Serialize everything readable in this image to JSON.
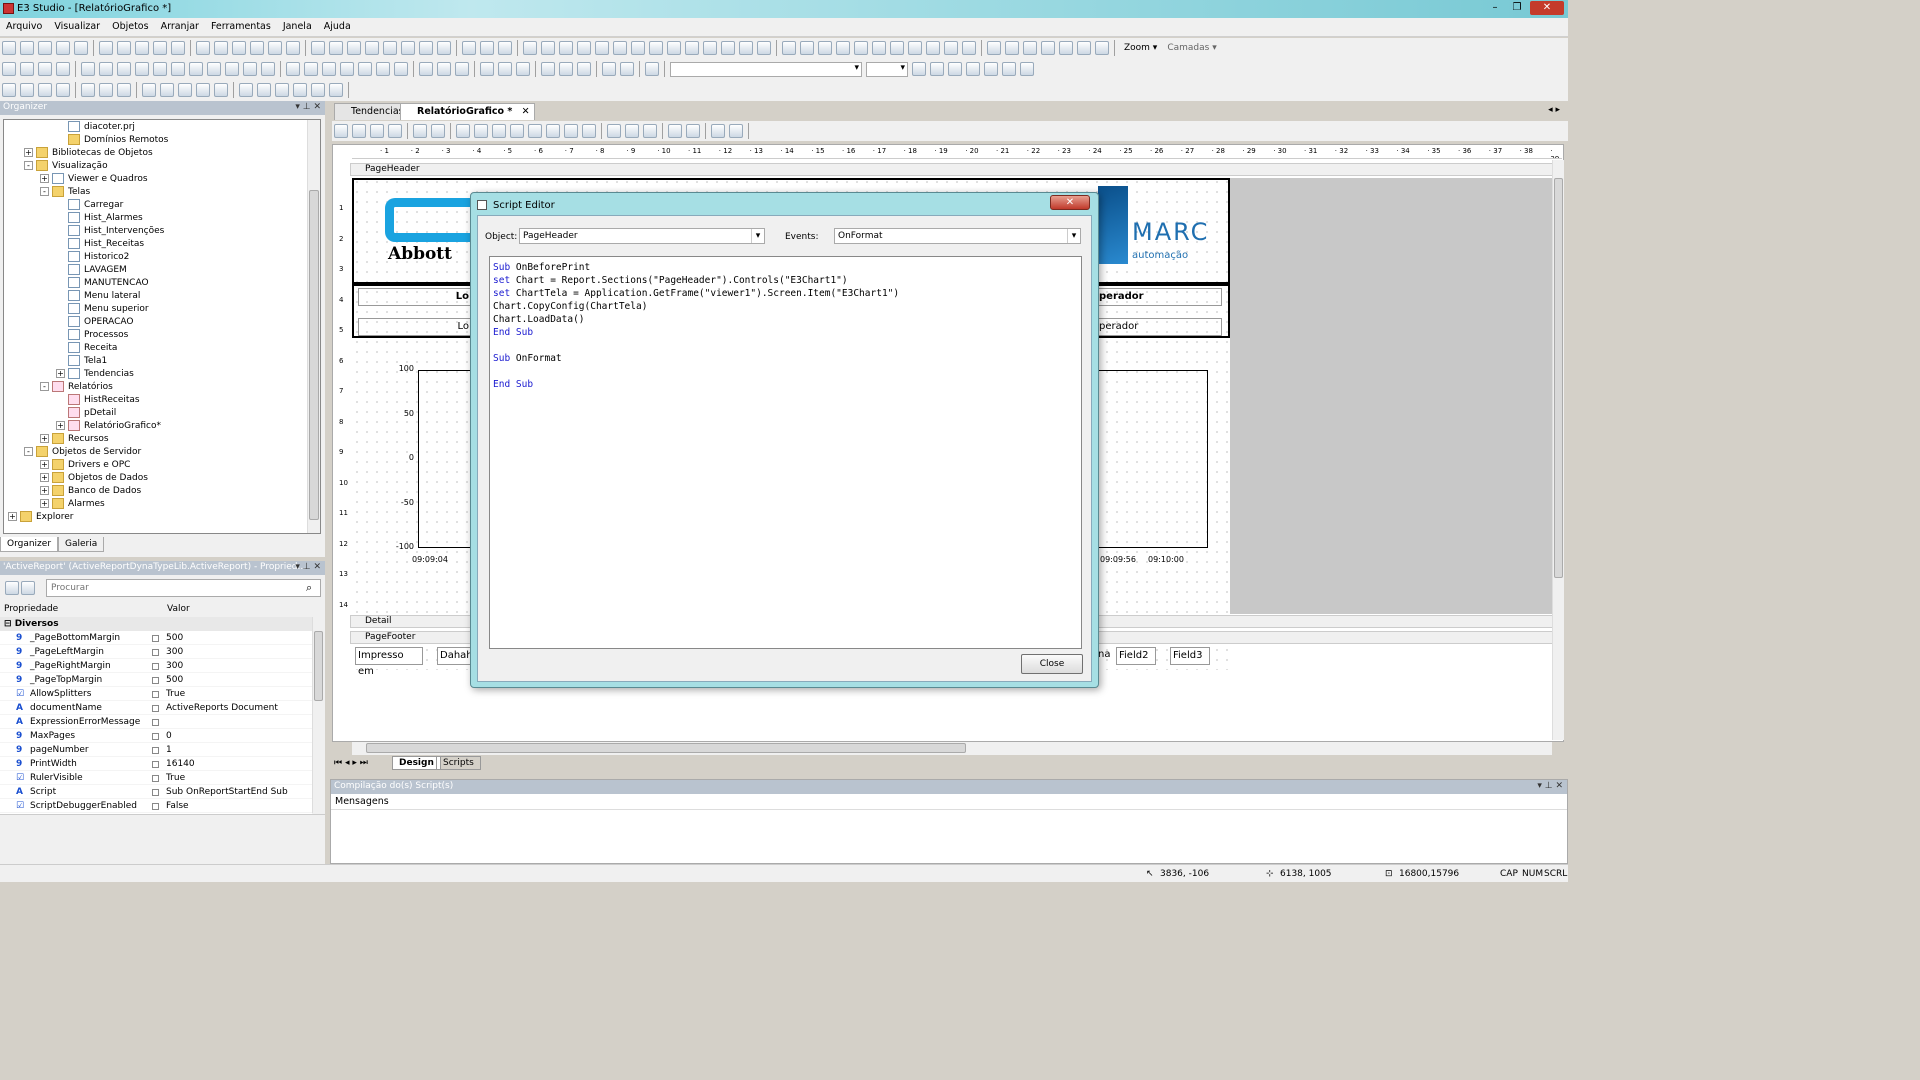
{
  "app": {
    "title": "E3 Studio - [RelatórioGrafico *]"
  },
  "menu": [
    "Arquivo",
    "Visualizar",
    "Objetos",
    "Arranjar",
    "Ferramentas",
    "Janela",
    "Ajuda"
  ],
  "toolbar": {
    "zoom_label": "Zoom",
    "layers_label": "Camadas"
  },
  "organizer": {
    "title": "Organizer",
    "tree": [
      {
        "label": "diacoter.prj",
        "level": 3,
        "icon": "page"
      },
      {
        "label": "Domínios Remotos",
        "level": 3,
        "icon": "fold"
      },
      {
        "label": "Bibliotecas de Objetos",
        "level": 1,
        "icon": "fold",
        "exp": "+"
      },
      {
        "label": "Visualização",
        "level": 1,
        "icon": "fold",
        "exp": "-"
      },
      {
        "label": "Viewer e Quadros",
        "level": 2,
        "icon": "page",
        "exp": "+"
      },
      {
        "label": "Telas",
        "level": 2,
        "icon": "fold",
        "exp": "-"
      },
      {
        "label": "Carregar",
        "level": 3,
        "icon": "page"
      },
      {
        "label": "Hist_Alarmes",
        "level": 3,
        "icon": "page"
      },
      {
        "label": "Hist_Intervenções",
        "level": 3,
        "icon": "page"
      },
      {
        "label": "Hist_Receitas",
        "level": 3,
        "icon": "page"
      },
      {
        "label": "Historico2",
        "level": 3,
        "icon": "page"
      },
      {
        "label": "LAVAGEM",
        "level": 3,
        "icon": "page"
      },
      {
        "label": "MANUTENCAO",
        "level": 3,
        "icon": "page"
      },
      {
        "label": "Menu lateral",
        "level": 3,
        "icon": "page"
      },
      {
        "label": "Menu superior",
        "level": 3,
        "icon": "page"
      },
      {
        "label": "OPERACAO",
        "level": 3,
        "icon": "page"
      },
      {
        "label": "Processos",
        "level": 3,
        "icon": "page"
      },
      {
        "label": "Receita",
        "level": 3,
        "icon": "page"
      },
      {
        "label": "Tela1",
        "level": 3,
        "icon": "page"
      },
      {
        "label": "Tendencias",
        "level": 3,
        "icon": "page",
        "exp": "+"
      },
      {
        "label": "Relatórios",
        "level": 2,
        "icon": "rep",
        "exp": "-"
      },
      {
        "label": "HistReceitas",
        "level": 3,
        "icon": "rep"
      },
      {
        "label": "pDetail",
        "level": 3,
        "icon": "rep"
      },
      {
        "label": "RelatórioGrafico*",
        "level": 3,
        "icon": "rep",
        "exp": "+"
      },
      {
        "label": "Recursos",
        "level": 2,
        "icon": "fold",
        "exp": "+"
      },
      {
        "label": "Objetos de Servidor",
        "level": 1,
        "icon": "fold",
        "exp": "-"
      },
      {
        "label": "Drivers e OPC",
        "level": 2,
        "icon": "fold",
        "exp": "+"
      },
      {
        "label": "Objetos de Dados",
        "level": 2,
        "icon": "fold",
        "exp": "+"
      },
      {
        "label": "Banco de Dados",
        "level": 2,
        "icon": "fold",
        "exp": "+"
      },
      {
        "label": "Alarmes",
        "level": 2,
        "icon": "fold",
        "exp": "+"
      },
      {
        "label": "Explorer",
        "level": 0,
        "icon": "fold",
        "exp": "+"
      }
    ],
    "tabs": [
      "Organizer",
      "Galeria"
    ]
  },
  "properties": {
    "title": "'ActiveReport' (ActiveReportDynaTypeLib.ActiveReport) - Propried...",
    "search_placeholder": "Procurar",
    "col_prop": "Propriedade",
    "col_value": "Valor",
    "group": "Diversos",
    "rows": [
      {
        "icon": "9",
        "name": "_PageBottomMargin",
        "value": "500"
      },
      {
        "icon": "9",
        "name": "_PageLeftMargin",
        "value": "300"
      },
      {
        "icon": "9",
        "name": "_PageRightMargin",
        "value": "300"
      },
      {
        "icon": "9",
        "name": "_PageTopMargin",
        "value": "500"
      },
      {
        "icon": "☑",
        "name": "AllowSplitters",
        "value": "True"
      },
      {
        "icon": "A",
        "name": "documentName",
        "value": "ActiveReports Document"
      },
      {
        "icon": "A",
        "name": "ExpressionErrorMessage",
        "value": ""
      },
      {
        "icon": "9",
        "name": "MaxPages",
        "value": "0"
      },
      {
        "icon": "9",
        "name": "pageNumber",
        "value": "1"
      },
      {
        "icon": "9",
        "name": "PrintWidth",
        "value": "16140"
      },
      {
        "icon": "☑",
        "name": "RulerVisible",
        "value": "True"
      },
      {
        "icon": "A",
        "name": "Script",
        "value": "Sub OnReportStartEnd Sub"
      },
      {
        "icon": "☑",
        "name": "ScriptDebuggerEnabled",
        "value": "False"
      }
    ]
  },
  "doc_tabs": [
    "Tendencias",
    "RelatórioGrafico *"
  ],
  "report": {
    "page_header": "PageHeader",
    "detail": "Detail",
    "page_footer": "PageFooter",
    "logo_left": "Abbott",
    "logo_right": "MARC",
    "logo_right_sub": "automação",
    "label_lo": "Lo",
    "label_operador": "perador",
    "chart_y": [
      "100",
      "50",
      "0",
      "-50",
      "-100"
    ],
    "chart_x": [
      "09:09:04",
      "09:09:56",
      "09:10:00"
    ],
    "footer_fields": [
      "Impresso em",
      "Dahah",
      "na",
      "Field2",
      "Field3"
    ],
    "ruler_marks": [
      "1",
      "2",
      "3",
      "4",
      "5",
      "6",
      "7",
      "8",
      "9",
      "10",
      "11",
      "12",
      "13",
      "14",
      "15",
      "16",
      "17",
      "18",
      "19",
      "20",
      "21",
      "22",
      "23",
      "24",
      "25",
      "26",
      "27",
      "28",
      "29",
      "30",
      "31",
      "32",
      "33",
      "34",
      "35",
      "36",
      "37",
      "38",
      "39"
    ],
    "vruler_marks": [
      "1",
      "2",
      "3",
      "4",
      "5",
      "6",
      "7",
      "8",
      "9",
      "10",
      "11",
      "12",
      "13",
      "14"
    ]
  },
  "bottom_tabs": [
    "Design",
    "Scripts"
  ],
  "script_editor": {
    "title": "Script Editor",
    "object_label": "Object:",
    "object_value": "PageHeader",
    "events_label": "Events:",
    "events_value": "OnFormat",
    "close_label": "Close",
    "code": [
      [
        {
          "k": true,
          "t": "Sub"
        },
        {
          "t": " OnBeforePrint"
        }
      ],
      [
        {
          "k": true,
          "t": "set"
        },
        {
          "t": " Chart = Report.Sections(\"PageHeader\").Controls(\"E3Chart1\")"
        }
      ],
      [
        {
          "k": true,
          "t": "set"
        },
        {
          "t": " ChartTela = Application.GetFrame(\"viewer1\").Screen.Item(\"E3Chart1\")"
        }
      ],
      [
        {
          "t": "Chart.CopyConfig(ChartTela)"
        }
      ],
      [
        {
          "t": "Chart.LoadData()"
        }
      ],
      [
        {
          "k": true,
          "t": "End Sub"
        }
      ],
      [
        {
          "t": ""
        }
      ],
      [
        {
          "k": true,
          "t": "Sub"
        },
        {
          "t": " OnFormat"
        }
      ],
      [
        {
          "t": ""
        }
      ],
      [
        {
          "k": true,
          "t": "End Sub"
        }
      ]
    ]
  },
  "compile": {
    "title": "Compilação do(s) Script(s)",
    "messages": "Mensagens"
  },
  "status": {
    "cursor": "3836, -106",
    "pos": "6138, 1005",
    "size": "16800,15796",
    "caps": "CAP",
    "num": "NUM",
    "scrl": "SCRL"
  }
}
